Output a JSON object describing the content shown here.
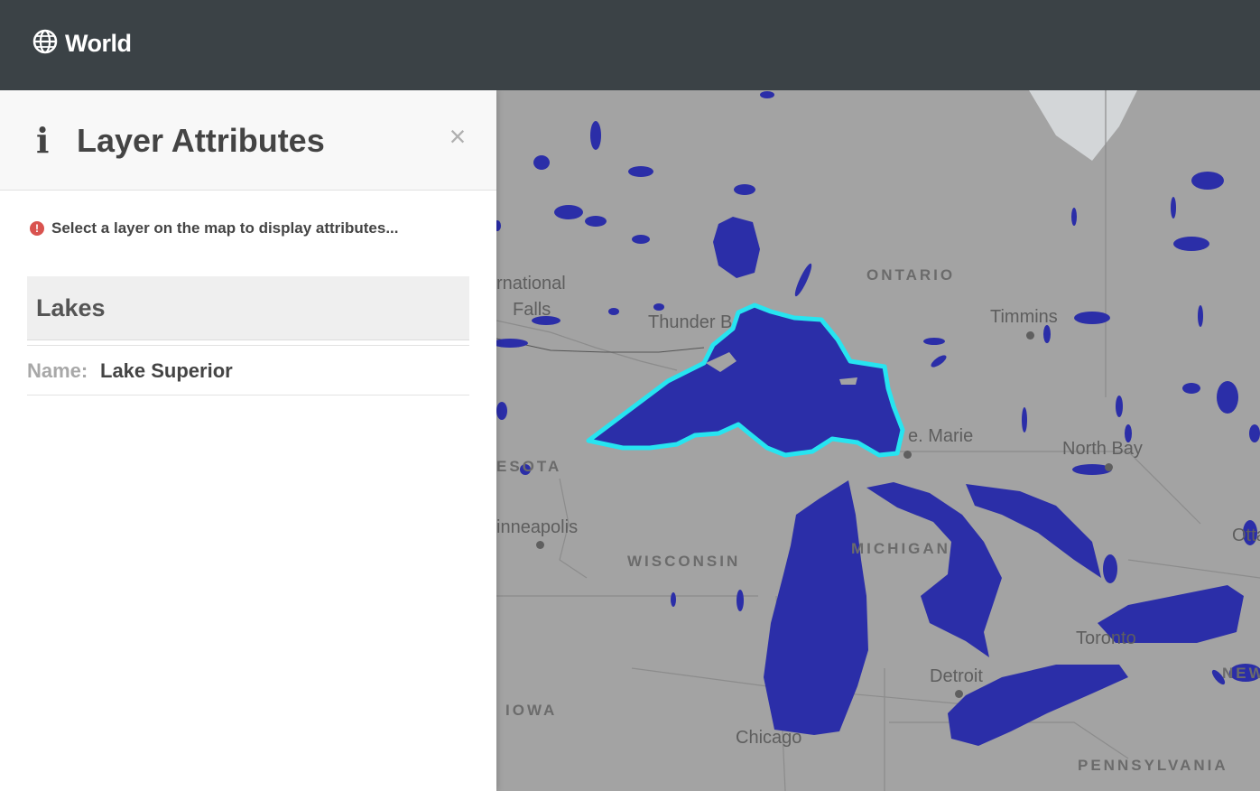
{
  "app": {
    "title": "World"
  },
  "panel": {
    "title": "Layer Attributes",
    "close_symbol": "×",
    "hint": "Select a layer on the map to display attributes...",
    "layer_name": "Lakes",
    "attribute": {
      "key": "Name:",
      "value": "Lake Superior"
    }
  },
  "map": {
    "labels": {
      "ontario": "ONTARIO",
      "international_falls_1": "rnational",
      "international_falls_2": "Falls",
      "thunder_bay": "Thunder B",
      "timmins": "Timmins",
      "sault_ste_marie": "e. Marie",
      "north_bay": "North Bay",
      "minnesota": "ESOTA",
      "minneapolis": "inneapolis",
      "wisconsin": "WISCONSIN",
      "michigan": "MICHIGAN",
      "ottawa": "Otta",
      "toronto": "Toronto",
      "detroit": "Detroit",
      "iowa": "IOWA",
      "chicago": "Chicago",
      "new_york": "NEW",
      "pennsylvania": "PENNSYLVANIA"
    },
    "colors": {
      "water": "#2b2ea8",
      "highlight": "#27e4f0",
      "land": "#a3a3a3"
    }
  }
}
